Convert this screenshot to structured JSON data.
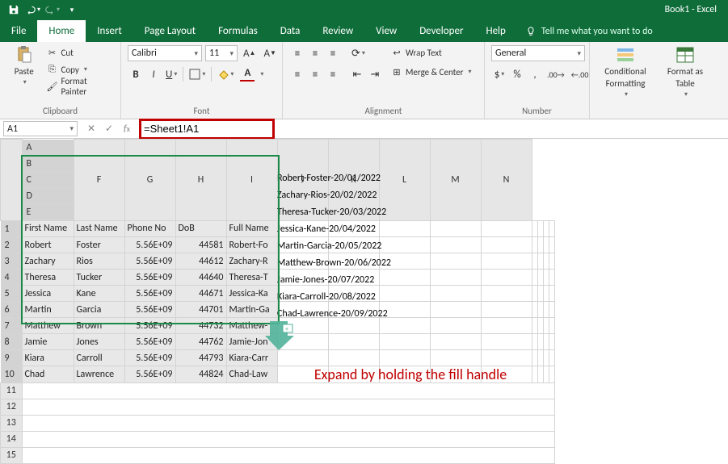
{
  "title": "Book1 - Excel",
  "qat": {
    "save": "save-icon",
    "undo": "undo-icon",
    "redo": "redo-icon"
  },
  "tabs": [
    "File",
    "Home",
    "Insert",
    "Page Layout",
    "Formulas",
    "Data",
    "Review",
    "View",
    "Developer",
    "Help"
  ],
  "active_tab": "Home",
  "tellme_placeholder": "Tell me what you want to do",
  "ribbon": {
    "clipboard": {
      "paste": "Paste",
      "cut": "Cut",
      "copy": "Copy",
      "format_painter": "Format Painter",
      "title": "Clipboard"
    },
    "font": {
      "name": "Calibri",
      "size": "11",
      "title": "Font"
    },
    "alignment": {
      "wrap": "Wrap Text",
      "merge": "Merge & Center",
      "title": "Alignment"
    },
    "number": {
      "format": "General",
      "title": "Number"
    },
    "styles": {
      "cond": "Conditional Formatting",
      "table": "Format as Table",
      "cond_line2": "Formatting",
      "table_line2": "Table"
    }
  },
  "namebox": "A1",
  "formula": "=Sheet1!A1",
  "columns": [
    "A",
    "B",
    "C",
    "D",
    "E",
    "F",
    "G",
    "H",
    "I",
    "J",
    "K",
    "L",
    "M",
    "N"
  ],
  "rows": [
    "1",
    "2",
    "3",
    "4",
    "5",
    "6",
    "7",
    "8",
    "9",
    "10",
    "11",
    "12",
    "13",
    "14",
    "15"
  ],
  "headers": {
    "A": "First Name",
    "B": "Last Name",
    "C": "Phone No",
    "D": "DoB",
    "E": "Full Name"
  },
  "data": [
    {
      "A": "Robert",
      "B": "Foster",
      "C": "5.56E+09",
      "D": "44581",
      "E": "Robert-Foster-20/01/2022"
    },
    {
      "A": "Zachary",
      "B": "Rios",
      "C": "5.56E+09",
      "D": "44612",
      "E": "Zachary-Rios-20/02/2022"
    },
    {
      "A": "Theresa",
      "B": "Tucker",
      "C": "5.56E+09",
      "D": "44640",
      "E": "Theresa-Tucker-20/03/2022"
    },
    {
      "A": "Jessica",
      "B": "Kane",
      "C": "5.56E+09",
      "D": "44671",
      "E": "Jessica-Kane-20/04/2022"
    },
    {
      "A": "Martin",
      "B": "Garcia",
      "C": "5.56E+09",
      "D": "44701",
      "E": "Martin-Garcia-20/05/2022"
    },
    {
      "A": "Matthew",
      "B": "Brown",
      "C": "5.56E+09",
      "D": "44732",
      "E": "Matthew-Brown-20/06/2022"
    },
    {
      "A": "Jamie",
      "B": "Jones",
      "C": "5.56E+09",
      "D": "44762",
      "E": "Jamie-Jones-20/07/2022"
    },
    {
      "A": "Kiara",
      "B": "Carroll",
      "C": "5.56E+09",
      "D": "44793",
      "E": "Kiara-Carroll-20/08/2022"
    },
    {
      "A": "Chad",
      "B": "Lawrence",
      "C": "5.56E+09",
      "D": "44824",
      "E": "Chad-Lawrence-20/09/2022"
    }
  ],
  "annotation": "Expand by holding the fill handle",
  "chart_data": {
    "type": "table",
    "columns": [
      "First Name",
      "Last Name",
      "Phone No",
      "DoB",
      "Full Name"
    ],
    "rows": [
      [
        "Robert",
        "Foster",
        "5.56E+09",
        "44581",
        "Robert-Foster-20/01/2022"
      ],
      [
        "Zachary",
        "Rios",
        "5.56E+09",
        "44612",
        "Zachary-Rios-20/02/2022"
      ],
      [
        "Theresa",
        "Tucker",
        "5.56E+09",
        "44640",
        "Theresa-Tucker-20/03/2022"
      ],
      [
        "Jessica",
        "Kane",
        "5.56E+09",
        "44671",
        "Jessica-Kane-20/04/2022"
      ],
      [
        "Martin",
        "Garcia",
        "5.56E+09",
        "44701",
        "Martin-Garcia-20/05/2022"
      ],
      [
        "Matthew",
        "Brown",
        "5.56E+09",
        "44732",
        "Matthew-Brown-20/06/2022"
      ],
      [
        "Jamie",
        "Jones",
        "5.56E+09",
        "44762",
        "Jamie-Jones-20/07/2022"
      ],
      [
        "Kiara",
        "Carroll",
        "5.56E+09",
        "44793",
        "Kiara-Carroll-20/08/2022"
      ],
      [
        "Chad",
        "Lawrence",
        "5.56E+09",
        "44824",
        "Chad-Lawrence-20/09/2022"
      ]
    ]
  }
}
